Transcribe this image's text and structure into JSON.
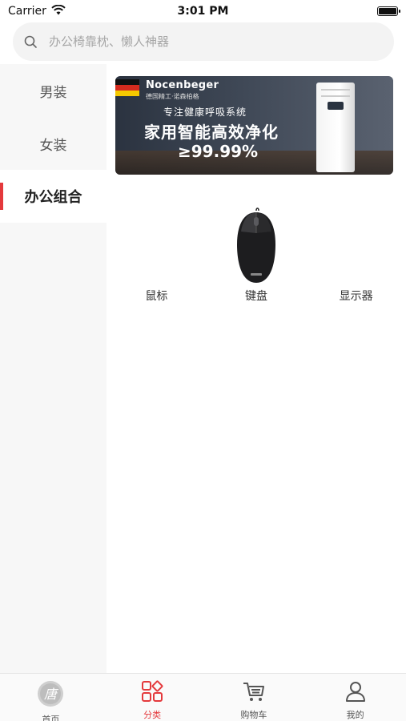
{
  "status_bar": {
    "carrier": "Carrier",
    "time": "3:01 PM"
  },
  "search": {
    "placeholder": "办公椅靠枕、懒人神器"
  },
  "sidebar": {
    "items": [
      {
        "label": "男装",
        "active": false
      },
      {
        "label": "女装",
        "active": false
      },
      {
        "label": "办公组合",
        "active": true
      }
    ]
  },
  "banner": {
    "brand": "Nocenbeger",
    "brand_sub": "德国精工·诺森柏格",
    "line1": "专注健康呼吸系统",
    "line2": "家用智能高效净化",
    "line3": "≥99.99%"
  },
  "subcategories": [
    {
      "label": "鼠标",
      "icon": "mouse-image"
    },
    {
      "label": "键盘",
      "icon": "keyboard-image"
    },
    {
      "label": "显示器",
      "icon": "monitor-image"
    }
  ],
  "tabbar": {
    "items": [
      {
        "label": "首页",
        "icon": "home-logo-icon"
      },
      {
        "label": "分类",
        "icon": "category-icon",
        "active": true
      },
      {
        "label": "购物车",
        "icon": "cart-icon"
      },
      {
        "label": "我的",
        "icon": "user-icon"
      }
    ]
  },
  "colors": {
    "accent": "#e4393c",
    "sidebar_bg": "#f7f7f7",
    "search_bg": "#f3f3f3"
  }
}
